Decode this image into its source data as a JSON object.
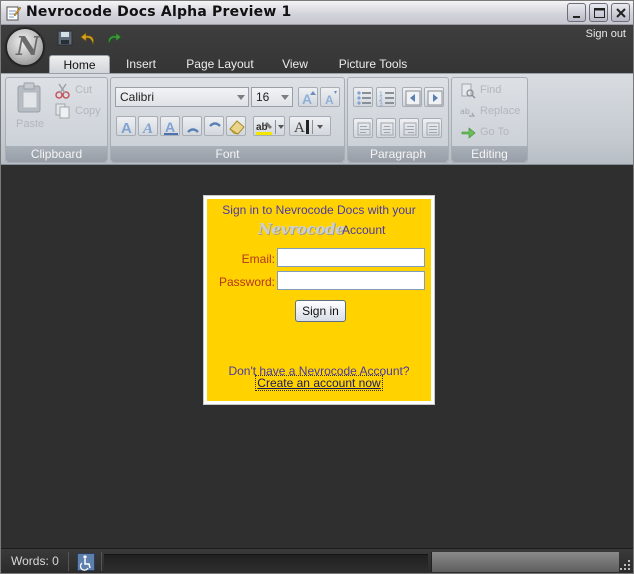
{
  "window": {
    "title": "Nevrocode Docs Alpha Preview 1"
  },
  "header": {
    "orb_letter": "N",
    "sign_out": "Sign out"
  },
  "tabs": [
    {
      "label": "Home",
      "active": true
    },
    {
      "label": "Insert"
    },
    {
      "label": "Page Layout"
    },
    {
      "label": "View"
    },
    {
      "label": "Picture Tools"
    }
  ],
  "ribbon": {
    "clipboard": {
      "label": "Clipboard",
      "paste": "Paste",
      "cut": "Cut",
      "copy": "Copy"
    },
    "font": {
      "label": "Font",
      "font_name": "Calibri",
      "font_size": "16"
    },
    "paragraph": {
      "label": "Paragraph"
    },
    "editing": {
      "label": "Editing",
      "find": "Find",
      "replace": "Replace",
      "goto": "Go To"
    }
  },
  "signin": {
    "line1": "Sign in to Nevrocode Docs with your",
    "brand": "Nevrocode",
    "account_word": "Account",
    "email_label": "Email:",
    "email_value": "",
    "password_label": "Password:",
    "password_value": "",
    "button": "Sign in",
    "no_account": "Don't have a Nevrocode Account?",
    "create_link": "Create an account now"
  },
  "status": {
    "words": "Words: 0"
  },
  "colors": {
    "panel": "#ffd200",
    "panel_text": "#4a3aa8",
    "label_text": "#b3361e",
    "background": "#2f2f2f"
  }
}
